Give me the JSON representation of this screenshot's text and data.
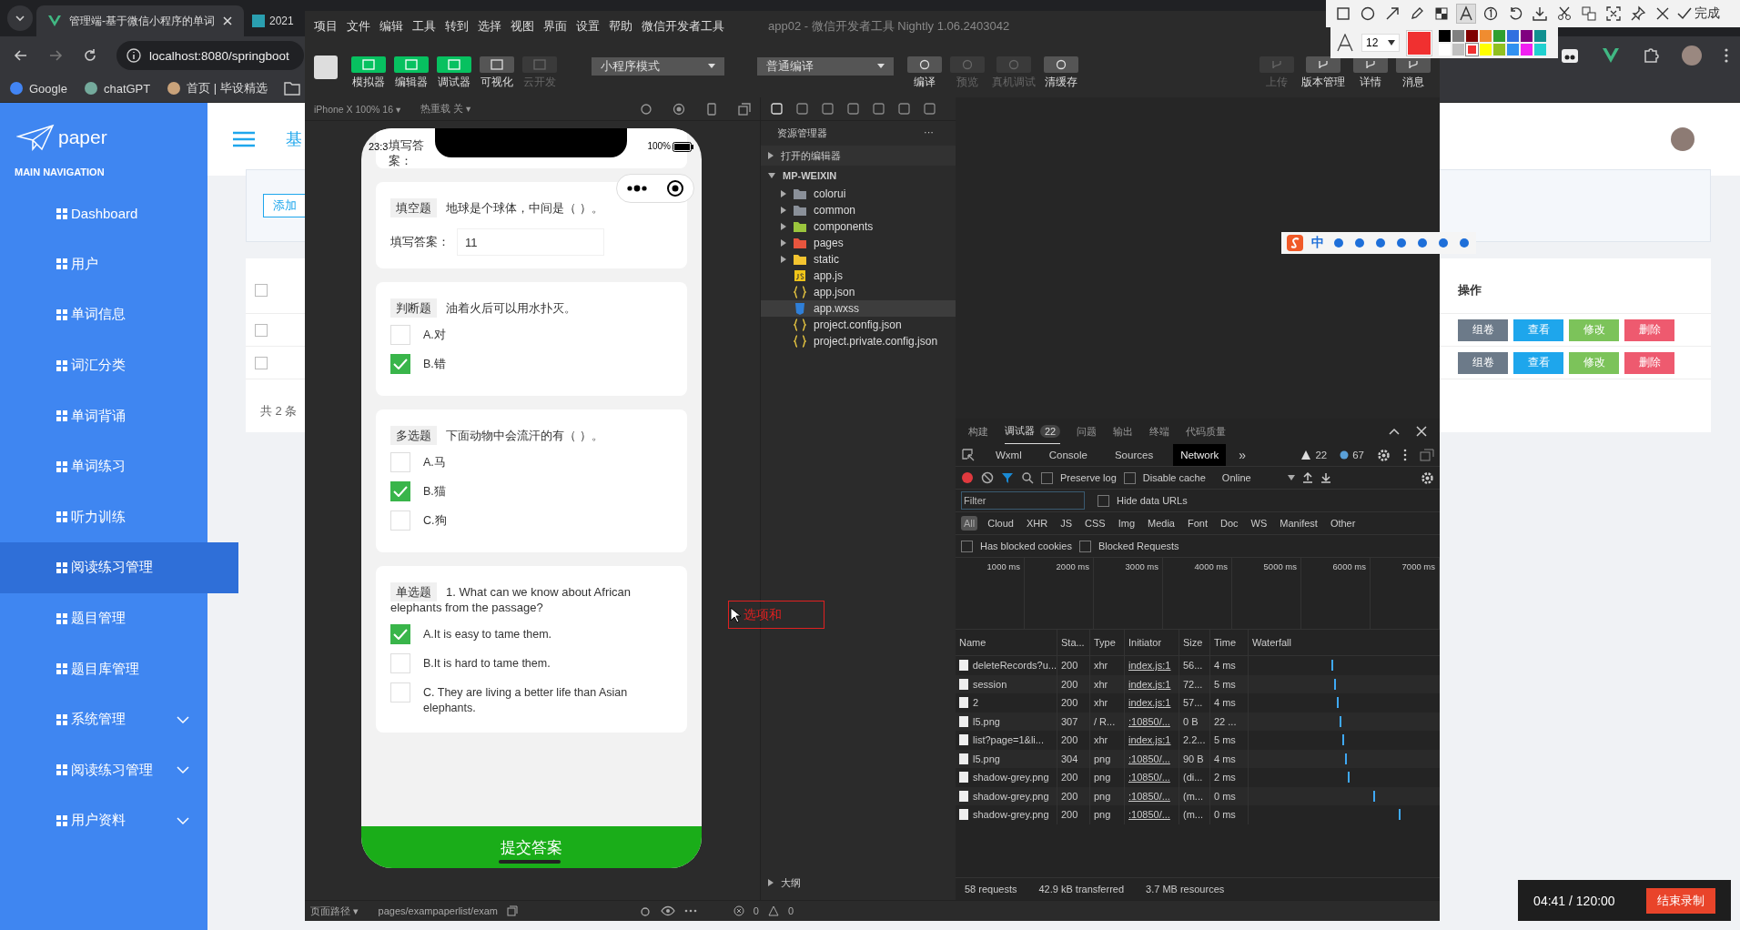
{
  "browser": {
    "tabs": [
      {
        "title": "管理端-基于微信小程序的单词",
        "selected": true
      },
      {
        "title": "2021",
        "selected": false
      }
    ],
    "url": "localhost:8080/springboot",
    "bookmarks": [
      "Google",
      "chatGPT",
      "首页 | 毕设精选"
    ]
  },
  "admin": {
    "logo": "paper",
    "nav_heading": "MAIN NAVIGATION",
    "nav": [
      {
        "label": "Dashboard",
        "selected": false,
        "expandable": false
      },
      {
        "label": "用户",
        "selected": false,
        "expandable": false
      },
      {
        "label": "单词信息",
        "selected": false,
        "expandable": false
      },
      {
        "label": "词汇分类",
        "selected": false,
        "expandable": false
      },
      {
        "label": "单词背诵",
        "selected": false,
        "expandable": false
      },
      {
        "label": "单词练习",
        "selected": false,
        "expandable": false
      },
      {
        "label": "听力训练",
        "selected": false,
        "expandable": false
      },
      {
        "label": "阅读练习管理",
        "selected": true,
        "expandable": false
      },
      {
        "label": "题目管理",
        "selected": false,
        "expandable": false
      },
      {
        "label": "题目库管理",
        "selected": false,
        "expandable": false
      },
      {
        "label": "系统管理",
        "selected": false,
        "expandable": true
      },
      {
        "label": "阅读练习管理",
        "selected": false,
        "expandable": true
      },
      {
        "label": "用户资料",
        "selected": false,
        "expandable": true
      }
    ],
    "header_title": "基",
    "add_button": "添加",
    "header_checked": false,
    "actions_header": "操作",
    "rows": [
      {
        "checked": false,
        "actions": [
          {
            "label": "组卷",
            "color": "#6c7a89"
          },
          {
            "label": "查看",
            "color": "#1ea6ec"
          },
          {
            "label": "修改",
            "color": "#7cc35a"
          },
          {
            "label": "删除",
            "color": "#ee5a6f"
          }
        ]
      },
      {
        "checked": false,
        "actions": [
          {
            "label": "组卷",
            "color": "#6c7a89"
          },
          {
            "label": "查看",
            "color": "#1ea6ec"
          },
          {
            "label": "修改",
            "color": "#7cc35a"
          },
          {
            "label": "删除",
            "color": "#ee5a6f"
          }
        ]
      }
    ],
    "total": "共 2 条"
  },
  "devtools": {
    "menu": [
      "项目",
      "文件",
      "编辑",
      "工具",
      "转到",
      "选择",
      "视图",
      "界面",
      "设置",
      "帮助",
      "微信开发者工具"
    ],
    "title": "app02 - 微信开发者工具 Nightly 1.06.2403042",
    "view_buttons": [
      {
        "label": "模拟器",
        "on": true,
        "disabled": false
      },
      {
        "label": "编辑器",
        "on": true,
        "disabled": false
      },
      {
        "label": "调试器",
        "on": true,
        "disabled": false
      },
      {
        "label": "可视化",
        "on": false,
        "disabled": false
      },
      {
        "label": "云开发",
        "on": false,
        "disabled": true
      }
    ],
    "mode_select": "小程序模式",
    "compile_select": "普通编译",
    "compile_actions": [
      {
        "label": "编译",
        "disabled": false
      },
      {
        "label": "预览",
        "disabled": true
      },
      {
        "label": "真机调试",
        "disabled": true
      },
      {
        "label": "清缓存",
        "disabled": false
      }
    ],
    "right_actions": [
      {
        "label": "上传",
        "disabled": true
      },
      {
        "label": "版本管理",
        "disabled": false
      },
      {
        "label": "详情",
        "disabled": false
      },
      {
        "label": "消息",
        "disabled": false
      }
    ],
    "device": "iPhone X 100% 16 ▾",
    "hot_reload": "热重载 关 ▾",
    "phone": {
      "time": "23:3",
      "battery": "100%",
      "partial_label": "填写答案：",
      "submit": "提交答案",
      "questions": [
        {
          "kind": "fill",
          "type_label": "填空题",
          "text": "地球是个球体，中间是（ ）。",
          "answer_label": "填写答案：",
          "answer": "11"
        },
        {
          "kind": "choice",
          "type_label": "判断题",
          "text": "油着火后可以用水扑灭。",
          "options": [
            {
              "label": "A.对",
              "checked": false
            },
            {
              "label": "B.错",
              "checked": true
            }
          ]
        },
        {
          "kind": "choice",
          "type_label": "多选题",
          "text": "下面动物中会流汗的有（ ）。",
          "options": [
            {
              "label": "A.马",
              "checked": false
            },
            {
              "label": "B.猫",
              "checked": true
            },
            {
              "label": "C.狗",
              "checked": false
            }
          ]
        },
        {
          "kind": "choice",
          "type_label": "单选题",
          "text": "1. What can we know about African elephants from the passage?",
          "options": [
            {
              "label": "A.It is easy to tame them.",
              "checked": true
            },
            {
              "label": "B.It is hard to tame them.",
              "checked": false
            },
            {
              "label": "C. They are living a better life than Asian elephants.",
              "checked": false
            }
          ]
        }
      ]
    },
    "explorer": {
      "title": "资源管理器",
      "more": "···",
      "open_editors": "打开的编辑器",
      "project": "MP-WEIXIN",
      "outline": "大纲",
      "items": [
        {
          "name": "colorui",
          "kind": "folder",
          "color": "#8a9099",
          "selected": false
        },
        {
          "name": "common",
          "kind": "folder",
          "color": "#8a9099",
          "selected": false
        },
        {
          "name": "components",
          "kind": "folder",
          "color": "#9bc53d",
          "selected": false
        },
        {
          "name": "pages",
          "kind": "folder",
          "color": "#e8553e",
          "selected": false
        },
        {
          "name": "static",
          "kind": "folder",
          "color": "#f4c430",
          "selected": false
        },
        {
          "name": "app.js",
          "kind": "js",
          "selected": false
        },
        {
          "name": "app.json",
          "kind": "json",
          "selected": false
        },
        {
          "name": "app.wxss",
          "kind": "css",
          "selected": true
        },
        {
          "name": "project.config.json",
          "kind": "json",
          "selected": false
        },
        {
          "name": "project.private.config.json",
          "kind": "json",
          "selected": false
        }
      ]
    },
    "debugger": {
      "panel_tabs": [
        {
          "label": "构建",
          "selected": false
        },
        {
          "label": "调试器",
          "selected": true,
          "badge": "22"
        },
        {
          "label": "问题",
          "selected": false
        },
        {
          "label": "输出",
          "selected": false
        },
        {
          "label": "终端",
          "selected": false
        },
        {
          "label": "代码质量",
          "selected": false
        }
      ],
      "tabs": [
        {
          "label": "Wxml",
          "selected": false
        },
        {
          "label": "Console",
          "selected": false
        },
        {
          "label": "Sources",
          "selected": false
        },
        {
          "label": "Network",
          "selected": true
        }
      ],
      "more": "»",
      "warning_count": "22",
      "info_count": "67",
      "preserve_log": {
        "label": "Preserve log",
        "checked": false
      },
      "disable_cache": {
        "label": "Disable cache",
        "checked": false
      },
      "throttle": "Online",
      "filter_placeholder": "Filter",
      "hide_data_urls": {
        "label": "Hide data URLs",
        "checked": false
      },
      "types": [
        {
          "label": "All",
          "selected": true
        },
        {
          "label": "Cloud",
          "selected": false
        },
        {
          "label": "XHR",
          "selected": false
        },
        {
          "label": "JS",
          "selected": false
        },
        {
          "label": "CSS",
          "selected": false
        },
        {
          "label": "Img",
          "selected": false
        },
        {
          "label": "Media",
          "selected": false
        },
        {
          "label": "Font",
          "selected": false
        },
        {
          "label": "Doc",
          "selected": false
        },
        {
          "label": "WS",
          "selected": false
        },
        {
          "label": "Manifest",
          "selected": false
        },
        {
          "label": "Other",
          "selected": false
        }
      ],
      "blocked_cookies": {
        "label": "Has blocked cookies",
        "checked": false
      },
      "blocked_requests": {
        "label": "Blocked Requests",
        "checked": false
      },
      "timeline": [
        "1000 ms",
        "2000 ms",
        "3000 ms",
        "4000 ms",
        "5000 ms",
        "6000 ms",
        "7000 ms"
      ],
      "columns": [
        "Name",
        "Sta...",
        "Type",
        "Initiator",
        "Size",
        "Time",
        "Waterfall"
      ],
      "requests": [
        {
          "name": "deleteRecords?u...",
          "status": "200",
          "type": "xhr",
          "initiator": "index.js:1",
          "size": "56...",
          "time": "4 ms"
        },
        {
          "name": "session",
          "status": "200",
          "type": "xhr",
          "initiator": "index.js:1",
          "size": "72...",
          "time": "5 ms"
        },
        {
          "name": "2",
          "status": "200",
          "type": "xhr",
          "initiator": "index.js:1",
          "size": "57...",
          "time": "4 ms"
        },
        {
          "name": "l5.png",
          "status": "307",
          "type": "/ R...",
          "initiator": ":10850/...",
          "size": "0 B",
          "time": "22 ..."
        },
        {
          "name": "list?page=1&li...",
          "status": "200",
          "type": "xhr",
          "initiator": "index.js:1",
          "size": "2.2...",
          "time": "5 ms"
        },
        {
          "name": "l5.png",
          "status": "304",
          "type": "png",
          "initiator": ":10850/...",
          "size": "90 B",
          "time": "4 ms"
        },
        {
          "name": "shadow-grey.png",
          "status": "200",
          "type": "png",
          "initiator": ":10850/...",
          "size": "(di...",
          "time": "2 ms"
        },
        {
          "name": "shadow-grey.png",
          "status": "200",
          "type": "png",
          "initiator": ":10850/...",
          "size": "(m...",
          "time": "0 ms"
        },
        {
          "name": "shadow-grey.png",
          "status": "200",
          "type": "png",
          "initiator": ":10850/...",
          "size": "(m...",
          "time": "0 ms"
        }
      ],
      "summary": [
        "58 requests",
        "42.9 kB transferred",
        "3.7 MB resources"
      ]
    },
    "status": {
      "path_label": "页面路径 ▾",
      "path": "pages/exampaperlist/exam",
      "errors": "0",
      "warnings": "0"
    }
  },
  "capture": {
    "tools": [
      {
        "kind": "rect",
        "selected": false
      },
      {
        "kind": "ellipse",
        "selected": false
      },
      {
        "kind": "arrow",
        "selected": false
      },
      {
        "kind": "pen",
        "selected": false
      },
      {
        "kind": "mosaic",
        "selected": false
      },
      {
        "kind": "text",
        "selected": true
      },
      {
        "kind": "number",
        "selected": false
      },
      {
        "kind": "undo",
        "selected": false
      },
      {
        "kind": "save",
        "selected": false
      },
      {
        "kind": "cut",
        "selected": false
      },
      {
        "kind": "translate",
        "selected": false
      },
      {
        "kind": "scan",
        "selected": false
      },
      {
        "kind": "pin",
        "selected": false
      },
      {
        "kind": "close",
        "selected": false
      }
    ],
    "done": "完成",
    "font_size": "12",
    "palette": [
      {
        "color": "#000000",
        "selected": false
      },
      {
        "color": "#808080",
        "selected": false
      },
      {
        "color": "#800000",
        "selected": false
      },
      {
        "color": "#f08c30",
        "selected": false
      },
      {
        "color": "#30a030",
        "selected": false
      },
      {
        "color": "#3070e0",
        "selected": false
      },
      {
        "color": "#800080",
        "selected": false
      },
      {
        "color": "#109090",
        "selected": false
      },
      {
        "color": "#ffffff",
        "selected": false
      },
      {
        "color": "#c0c0c0",
        "selected": false
      },
      {
        "color": "#f03030",
        "selected": true
      },
      {
        "color": "#ffff00",
        "selected": false
      },
      {
        "color": "#90c020",
        "selected": false
      },
      {
        "color": "#3090f0",
        "selected": false
      },
      {
        "color": "#f020f0",
        "selected": false
      },
      {
        "color": "#20d0d0",
        "selected": false
      }
    ],
    "annotation_text": "选项和"
  },
  "ime": {
    "mode": "中"
  },
  "recording": {
    "time": "04:41 / 120:00",
    "stop": "结束录制"
  }
}
